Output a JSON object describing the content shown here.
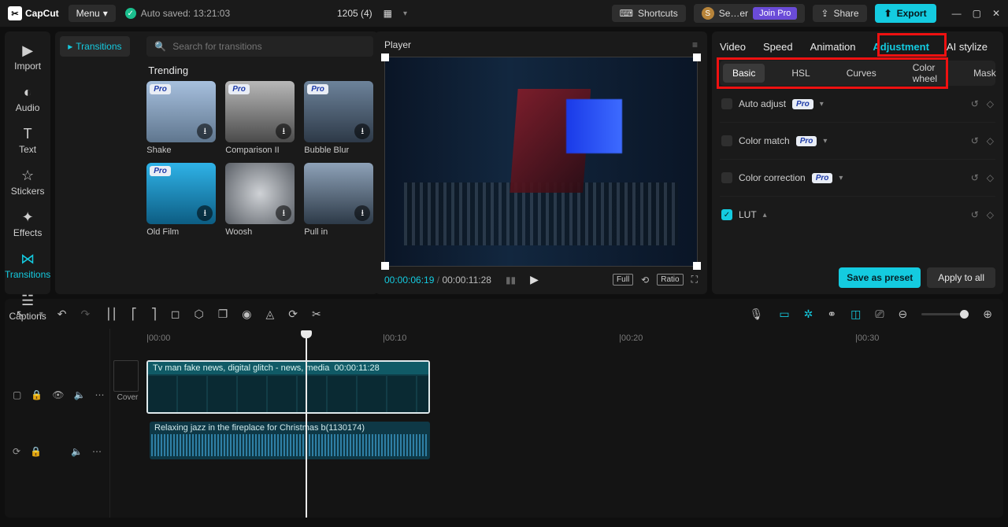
{
  "app": {
    "name": "CapCut",
    "menu": "Menu",
    "autosave": "Auto saved: 13:21:03"
  },
  "top": {
    "center_title": "1205 (4)",
    "shortcuts": "Shortcuts",
    "user_short": "Se…er",
    "joinpro": "Join Pro",
    "share": "Share",
    "export": "Export"
  },
  "leftTabs": {
    "import": "Import",
    "audio": "Audio",
    "text": "Text",
    "stickers": "Stickers",
    "effects": "Effects",
    "transitions": "Transitions",
    "captions": "Captions"
  },
  "panel": {
    "side_chip": "Transitions",
    "search_placeholder": "Search for transitions",
    "section": "Trending",
    "items": [
      {
        "label": "Shake",
        "pro": true
      },
      {
        "label": "Comparison II",
        "pro": true
      },
      {
        "label": "Bubble Blur",
        "pro": true
      },
      {
        "label": "Old Film",
        "pro": true
      },
      {
        "label": "Woosh",
        "pro": false
      },
      {
        "label": "Pull in",
        "pro": false
      }
    ]
  },
  "player": {
    "title": "Player",
    "time_current": "00:00:06:19",
    "time_total": "00:00:11:28",
    "btn_full": "Full",
    "btn_ratio": "Ratio"
  },
  "inspector": {
    "tabs": {
      "video": "Video",
      "speed": "Speed",
      "animation": "Animation",
      "adjustment": "Adjustment",
      "aistyle": "AI stylize"
    },
    "subtabs": {
      "basic": "Basic",
      "hsl": "HSL",
      "curves": "Curves",
      "colorwheel": "Color wheel",
      "mask": "Mask"
    },
    "rows": {
      "auto": "Auto adjust",
      "match": "Color match",
      "corr": "Color correction",
      "lut": "LUT"
    },
    "save_preset": "Save as preset",
    "apply_all": "Apply to all",
    "pro": "Pro"
  },
  "ruler": {
    "t0": "|00:00",
    "t1": "|00:10",
    "t2": "|00:20",
    "t3": "|00:30"
  },
  "timeline": {
    "cover": "Cover",
    "video_clip": {
      "label": "Tv man fake news, digital glitch - news, media",
      "dur": "00:00:11:28"
    },
    "audio_clip": {
      "label": "Relaxing jazz in the fireplace for Christmas b(1130174)"
    }
  }
}
